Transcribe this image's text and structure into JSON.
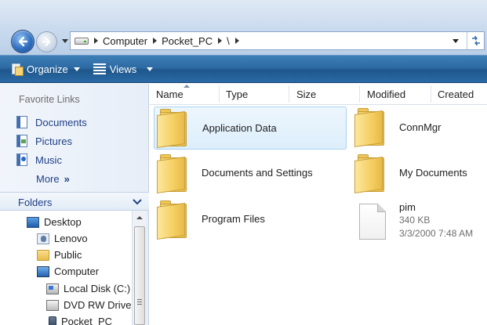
{
  "address": {
    "crumbs": [
      "Computer",
      "Pocket_PC",
      "\\"
    ]
  },
  "command_bar": {
    "organize_label": "Organize",
    "views_label": "Views"
  },
  "left_pane": {
    "favorites_title": "Favorite Links",
    "favorites": [
      {
        "label": "Documents",
        "icon": "documents-icon"
      },
      {
        "label": "Pictures",
        "icon": "pictures-icon"
      },
      {
        "label": "Music",
        "icon": "music-icon"
      }
    ],
    "more_label": "More",
    "more_glyph": "»",
    "folders_title": "Folders",
    "tree": [
      {
        "label": "Desktop",
        "icon": "desktop-icon"
      },
      {
        "label": "Lenovo",
        "icon": "user-folder-icon"
      },
      {
        "label": "Public",
        "icon": "folder-icon"
      },
      {
        "label": "Computer",
        "icon": "computer-icon"
      },
      {
        "label": "Local Disk (C:)",
        "icon": "local-disk-icon"
      },
      {
        "label": "DVD RW Drive",
        "icon": "dvd-drive-icon"
      },
      {
        "label": "Pocket_PC",
        "icon": "pocket-pc-icon"
      }
    ]
  },
  "columns": [
    "Name",
    "Type",
    "Size",
    "Modified",
    "Created"
  ],
  "items": [
    {
      "name": "Application Data",
      "kind": "folder",
      "selected": true
    },
    {
      "name": "ConnMgr",
      "kind": "folder"
    },
    {
      "name": "Documents and Settings",
      "kind": "folder"
    },
    {
      "name": "My Documents",
      "kind": "folder"
    },
    {
      "name": "Program Files",
      "kind": "folder"
    },
    {
      "name": "pim",
      "kind": "file",
      "size": "340 KB",
      "modified": "3/3/2000 7:48 AM"
    }
  ],
  "colors": {
    "command_bar": "#2c6aa3",
    "link_text": "#1e3f86",
    "selection_border": "#a9d3f2"
  }
}
